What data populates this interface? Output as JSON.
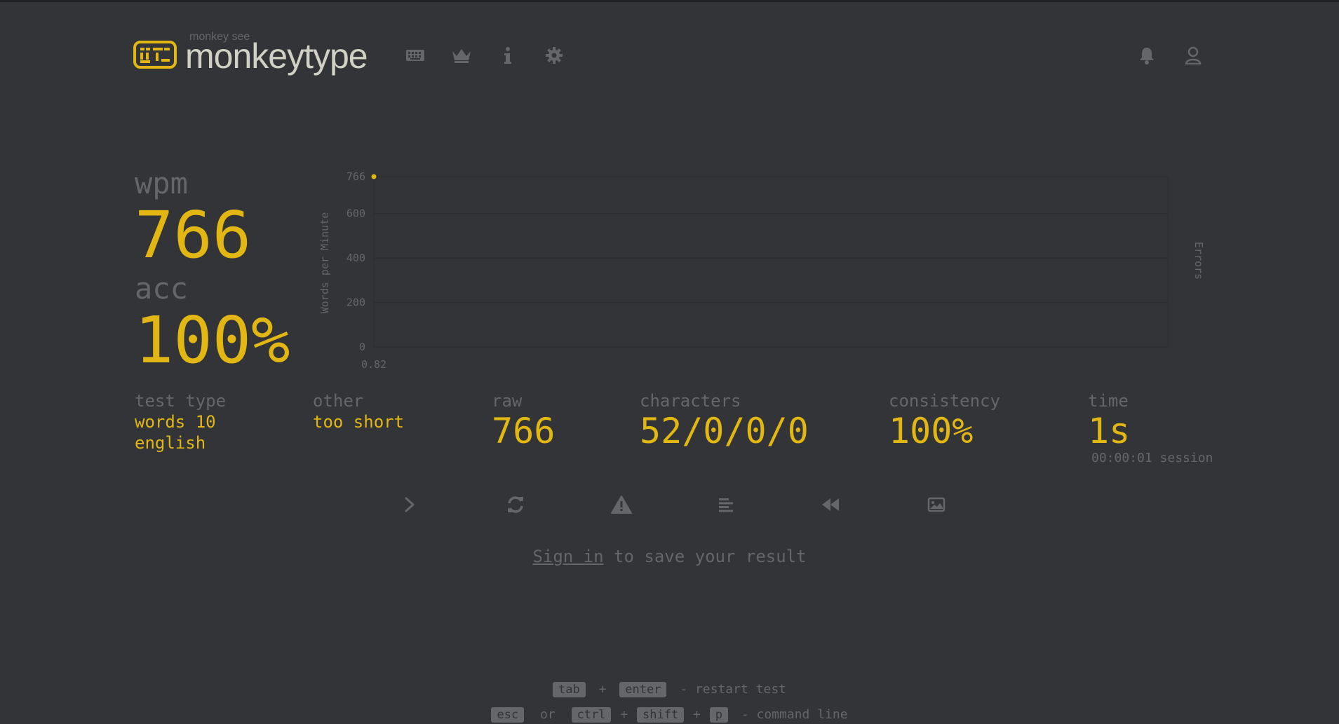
{
  "header": {
    "logo_small": "monkey see",
    "logo_text": "monkeytype",
    "nav": [
      {
        "icon": "keyboard-icon"
      },
      {
        "icon": "crown-icon"
      },
      {
        "icon": "info-icon"
      },
      {
        "icon": "gear-icon"
      }
    ],
    "right": [
      {
        "icon": "bell-icon"
      },
      {
        "icon": "user-icon"
      }
    ]
  },
  "stats": {
    "wpm_label": "wpm",
    "wpm_value": "766",
    "acc_label": "acc",
    "acc_value": "100%"
  },
  "chart_data": {
    "type": "line",
    "x": [
      0.82
    ],
    "series": [
      {
        "values": [
          766
        ]
      }
    ],
    "ylabel": "Words per Minute",
    "y2label": "Errors",
    "y_ticks": [
      "0",
      "200",
      "400",
      "600",
      "766"
    ],
    "x_ticks": [
      "0.82"
    ],
    "ylim": [
      0,
      766
    ],
    "colors": {
      "line": "#e2b714",
      "grid": "#2c2e31"
    }
  },
  "info": {
    "test_type_label": "test type",
    "test_type_line1": "words 10",
    "test_type_line2": "english",
    "other_label": "other",
    "other_value": "too short",
    "raw_label": "raw",
    "raw_value": "766",
    "characters_label": "characters",
    "characters_value": "52/0/0/0",
    "consistency_label": "consistency",
    "consistency_value": "100%",
    "time_label": "time",
    "time_value": "1s",
    "time_session": "00:00:01 session"
  },
  "actions": [
    {
      "icon": "next-test-icon"
    },
    {
      "icon": "restart-icon"
    },
    {
      "icon": "warning-icon"
    },
    {
      "icon": "words-history-icon"
    },
    {
      "icon": "replay-icon"
    },
    {
      "icon": "screenshot-icon"
    }
  ],
  "signin": {
    "link": "Sign in",
    "rest": " to save your result"
  },
  "footer": {
    "line1": {
      "k1": "tab",
      "plus": "+",
      "k2": "enter",
      "text": "- restart test"
    },
    "line2": {
      "k1": "esc",
      "or": "or",
      "k2": "ctrl",
      "plus1": "+",
      "k3": "shift",
      "plus2": "+",
      "k4": "p",
      "text": "- command line"
    }
  },
  "colors": {
    "background": "#323437",
    "accent": "#e2b714",
    "sub": "#646669",
    "text": "#d1d0c5"
  }
}
